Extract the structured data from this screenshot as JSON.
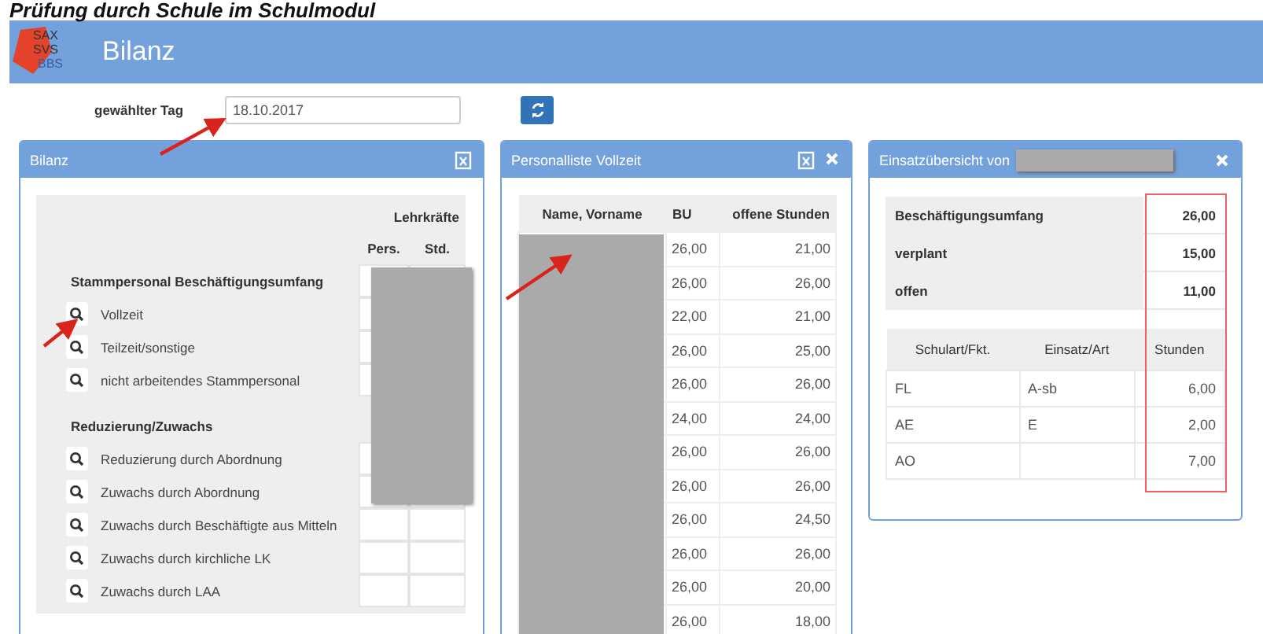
{
  "page_title": "Prüfung durch Schule im Schulmodul",
  "app": {
    "logo": [
      "SAX",
      "SVS",
      "BBS"
    ],
    "title": "Bilanz"
  },
  "date_filter": {
    "label": "gewählter Tag",
    "value": "18.10.2017"
  },
  "bilanz_panel": {
    "title": "Bilanz",
    "group_header": "Lehrkräfte",
    "columns": [
      "Pers.",
      "Std."
    ],
    "sections": [
      {
        "title": "Stammpersonal Beschäftigungsumfang",
        "rows": [
          {
            "label": "Vollzeit"
          },
          {
            "label": "Teilzeit/sonstige"
          },
          {
            "label": "nicht arbeitendes Stammpersonal"
          }
        ]
      },
      {
        "title": "Reduzierung/Zuwachs",
        "rows": [
          {
            "label": "Reduzierung durch Abordnung"
          },
          {
            "label": "Zuwachs durch Abordnung"
          },
          {
            "label": "Zuwachs durch Beschäftigte aus Mitteln"
          },
          {
            "label": "Zuwachs durch kirchliche LK"
          },
          {
            "label": "Zuwachs durch LAA"
          }
        ]
      }
    ]
  },
  "personal_panel": {
    "title": "Personalliste Vollzeit",
    "columns": [
      "Name, Vorname",
      "BU",
      "offene Stunden"
    ],
    "rows": [
      {
        "bu": "26,00",
        "offen": "21,00"
      },
      {
        "bu": "26,00",
        "offen": "26,00"
      },
      {
        "bu": "22,00",
        "offen": "21,00"
      },
      {
        "bu": "26,00",
        "offen": "25,00"
      },
      {
        "bu": "26,00",
        "offen": "26,00"
      },
      {
        "bu": "24,00",
        "offen": "24,00"
      },
      {
        "bu": "26,00",
        "offen": "26,00"
      },
      {
        "bu": "26,00",
        "offen": "26,00"
      },
      {
        "bu": "26,00",
        "offen": "24,50"
      },
      {
        "bu": "26,00",
        "offen": "26,00"
      },
      {
        "bu": "26,00",
        "offen": "20,00"
      },
      {
        "bu": "26,00",
        "offen": "18,00"
      }
    ]
  },
  "einsatz_panel": {
    "title": "Einsatzübersicht von",
    "summary": [
      {
        "label": "Beschäftigungsumfang",
        "value": "26,00"
      },
      {
        "label": "verplant",
        "value": "15,00"
      },
      {
        "label": "offen",
        "value": "11,00"
      }
    ],
    "columns": [
      "Schulart/Fkt.",
      "Einsatz/Art",
      "Stunden"
    ],
    "rows": [
      {
        "schulart": "FL",
        "einsatz": "A-sb",
        "stunden": "6,00"
      },
      {
        "schulart": "AE",
        "einsatz": "E",
        "stunden": "2,00"
      },
      {
        "schulart": "AO",
        "einsatz": "",
        "stunden": "7,00"
      }
    ]
  }
}
